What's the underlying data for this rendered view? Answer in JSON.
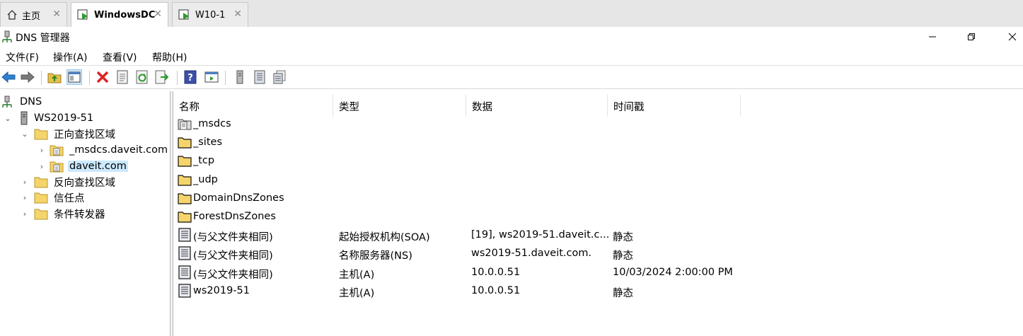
{
  "tabs": [
    {
      "label": "主页",
      "icon": "home-icon"
    },
    {
      "label": "WindowsDC",
      "icon": "vm-icon"
    },
    {
      "label": "W10-1",
      "icon": "vm-icon"
    }
  ],
  "window": {
    "title": "DNS 管理器"
  },
  "menu": [
    "文件(F)",
    "操作(A)",
    "查看(V)",
    "帮助(H)"
  ],
  "tree": {
    "root": "DNS",
    "server": "WS2019-51",
    "forward_zones": "正向查找区域",
    "zone_msdcs": "_msdcs.daveit.com",
    "zone_daveit": "daveit.com",
    "reverse_zones": "反向查找区域",
    "trust_points": "信任点",
    "conditional_forwarders": "条件转发器"
  },
  "columns": [
    "名称",
    "类型",
    "数据",
    "时间戳"
  ],
  "records": [
    {
      "name": "_msdcs",
      "type": "",
      "data": "",
      "timestamp": "",
      "icon": "delegation-icon"
    },
    {
      "name": "_sites",
      "type": "",
      "data": "",
      "timestamp": "",
      "icon": "folder-icon"
    },
    {
      "name": "_tcp",
      "type": "",
      "data": "",
      "timestamp": "",
      "icon": "folder-icon"
    },
    {
      "name": "_udp",
      "type": "",
      "data": "",
      "timestamp": "",
      "icon": "folder-icon"
    },
    {
      "name": "DomainDnsZones",
      "type": "",
      "data": "",
      "timestamp": "",
      "icon": "folder-icon"
    },
    {
      "name": "ForestDnsZones",
      "type": "",
      "data": "",
      "timestamp": "",
      "icon": "folder-icon"
    },
    {
      "name": "(与父文件夹相同)",
      "type": "起始授权机构(SOA)",
      "data": "[19], ws2019-51.daveit.c...",
      "timestamp": "静态",
      "icon": "record-icon"
    },
    {
      "name": "(与父文件夹相同)",
      "type": "名称服务器(NS)",
      "data": "ws2019-51.daveit.com.",
      "timestamp": "静态",
      "icon": "record-icon"
    },
    {
      "name": "(与父文件夹相同)",
      "type": "主机(A)",
      "data": "10.0.0.51",
      "timestamp": "10/03/2024 2:00:00 PM",
      "icon": "record-icon"
    },
    {
      "name": "ws2019-51",
      "type": "主机(A)",
      "data": "10.0.0.51",
      "timestamp": "静态",
      "icon": "record-icon"
    }
  ]
}
